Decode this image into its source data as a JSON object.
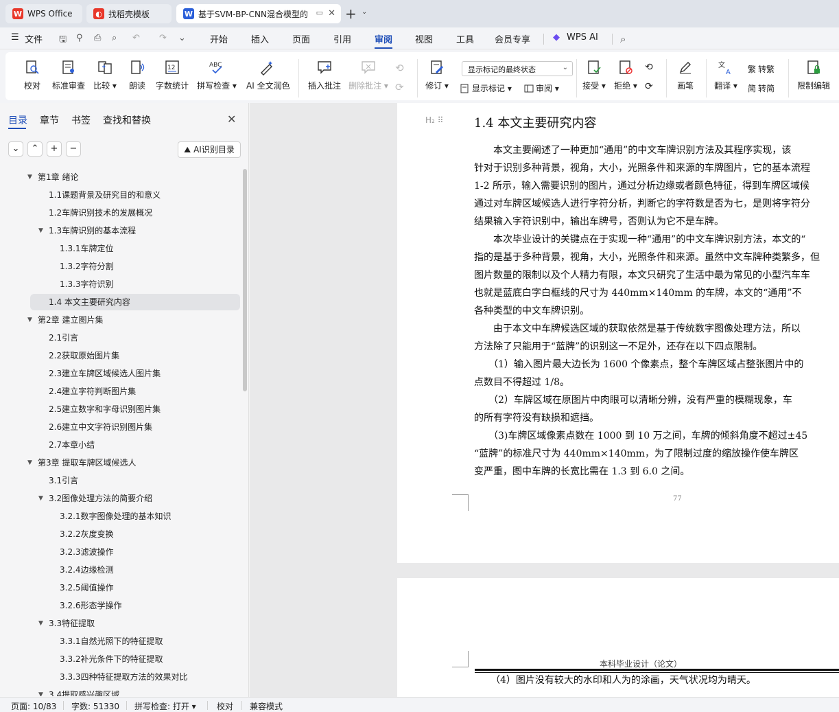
{
  "tabs": [
    {
      "label": "WPS Office",
      "icon": "wps-logo-icon",
      "color": "#e8372a"
    },
    {
      "label": "找稻壳模板",
      "icon": "daoke-icon",
      "color": "#e8372a"
    },
    {
      "label": "基于SVM-BP-CNN混合模型的",
      "icon": "word-doc-icon",
      "color": "#2b5fd9"
    }
  ],
  "menu": {
    "file": "文件",
    "items": [
      "开始",
      "插入",
      "页面",
      "引用",
      "审阅",
      "视图",
      "工具",
      "会员专享"
    ],
    "active": "审阅",
    "wps_ai": "WPS AI"
  },
  "ribbon": {
    "buttons": [
      {
        "label": "校对",
        "icon": "proofread-icon"
      },
      {
        "label": "标准审查",
        "icon": "standard-review-icon"
      },
      {
        "label": "比较 ▾",
        "icon": "compare-icon"
      },
      {
        "label": "朗读",
        "icon": "read-aloud-icon"
      },
      {
        "label": "字数统计",
        "icon": "word-count-icon"
      },
      {
        "label": "拼写检查 ▾",
        "icon": "spellcheck-icon"
      },
      {
        "label": "AI 全文润色",
        "icon": "ai-polish-icon"
      },
      {
        "label": "插入批注",
        "icon": "insert-comment-icon"
      },
      {
        "label": "删除批注 ▾",
        "icon": "delete-comment-icon"
      },
      {
        "label": "修订 ▾",
        "icon": "track-changes-icon"
      },
      {
        "label": "接受 ▾",
        "icon": "accept-icon"
      },
      {
        "label": "拒绝 ▾",
        "icon": "reject-icon"
      },
      {
        "label": "画笔",
        "icon": "pen-icon"
      },
      {
        "label": "翻译 ▾",
        "icon": "translate-icon"
      },
      {
        "label": "限制编辑",
        "icon": "restrict-edit-icon"
      }
    ],
    "markup_select": "显示标记的最终状态",
    "show_markup": "显示标记 ▾",
    "review": "审阅 ▾",
    "to_traditional": "转繁",
    "to_simplified": "转简"
  },
  "nav": {
    "tabs": [
      "目录",
      "章节",
      "书签",
      "查找和替换"
    ],
    "active_tab": "目录",
    "ai_toc": "AI识别目录",
    "toc": [
      {
        "text": "第1章 绪论",
        "level": 1,
        "caret": true
      },
      {
        "text": "1.1课题背景及研究目的和意义",
        "level": 2
      },
      {
        "text": "1.2车牌识别技术的发展概况",
        "level": 2
      },
      {
        "text": "1.3车牌识别的基本流程",
        "level": 2,
        "caret": true
      },
      {
        "text": "1.3.1车牌定位",
        "level": 3
      },
      {
        "text": "1.3.2字符分割",
        "level": 3
      },
      {
        "text": "1.3.3字符识别",
        "level": 3
      },
      {
        "text": "1.4 本文主要研究内容",
        "level": 2,
        "selected": true
      },
      {
        "text": "第2章 建立图片集",
        "level": 1,
        "caret": true
      },
      {
        "text": "2.1引言",
        "level": 2
      },
      {
        "text": "2.2获取原始图片集",
        "level": 2
      },
      {
        "text": "2.3建立车牌区域候选人图片集",
        "level": 2
      },
      {
        "text": "2.4建立字符判断图片集",
        "level": 2
      },
      {
        "text": "2.5建立数字和字母识别图片集",
        "level": 2
      },
      {
        "text": "2.6建立中文字符识别图片集",
        "level": 2
      },
      {
        "text": "2.7本章小结",
        "level": 2
      },
      {
        "text": "第3章 提取车牌区域候选人",
        "level": 1,
        "caret": true
      },
      {
        "text": "3.1引言",
        "level": 2
      },
      {
        "text": "3.2图像处理方法的简要介绍",
        "level": 2,
        "caret": true
      },
      {
        "text": "3.2.1数字图像处理的基本知识",
        "level": 3
      },
      {
        "text": "3.2.2灰度变换",
        "level": 3
      },
      {
        "text": "3.2.3滤波操作",
        "level": 3
      },
      {
        "text": "3.2.4边缘检测",
        "level": 3
      },
      {
        "text": "3.2.5阈值操作",
        "level": 3
      },
      {
        "text": "3.2.6形态学操作",
        "level": 3
      },
      {
        "text": "3.3特征提取",
        "level": 2,
        "caret": true
      },
      {
        "text": "3.3.1自然光照下的特征提取",
        "level": 3
      },
      {
        "text": "3.3.2补光条件下的特征提取",
        "level": 3
      },
      {
        "text": "3.3.3四种特征提取方法的效果对比",
        "level": 3
      },
      {
        "text": "3.4提取感兴趣区域",
        "level": 2,
        "caret": true
      }
    ]
  },
  "document": {
    "heading": "1.4 本文主要研究内容",
    "lines": [
      "　　本文主要阐述了一种更加“通用”的中文车牌识别方法及其程序实现，该",
      "针对于识别多种背景，视角，大小，光照条件和来源的车牌图片，它的基本流程",
      "1-2 所示，输入需要识别的图片，通过分析边缘或者颜色特征，得到车牌区域候",
      "通过对车牌区域候选人进行字符分析，判断它的字符数是否为七，是则将字符分",
      "结果输入字符识别中，输出车牌号，否则认为它不是车牌。",
      "　　本次毕业设计的关键点在于实现一种“通用”的中文车牌识别方法，本文的“",
      "指的是基于多种背景，视角，大小，光照条件和来源。虽然中文车牌种类繁多，但",
      "图片数量的限制以及个人精力有限，本文只研究了生活中最为常见的小型汽车车",
      "也就是蓝底白字白框线的尺寸为 440mm×140mm 的车牌，本文的“通用”不",
      "各种类型的中文车牌识别。",
      "　　由于本文中车牌候选区域的获取依然是基于传统数字图像处理方法，所以",
      "方法除了只能用于“蓝牌”的识别这一不足外，还存在以下四点限制。",
      "　　（1）输入图片最大边长为 1600 个像素点，整个车牌区域占整张图片中的",
      "点数目不得超过 1/8。",
      "　　（2）车牌区域在原图片中肉眼可以清晰分辨，没有严重的模糊现象，车",
      "的所有字符没有缺损和遮挡。",
      "　　（3)车牌区域像素点数在 1000 到 10 万之间，车牌的倾斜角度不超过±45",
      "“蓝牌”的标准尺寸为 440mm×140mm，为了限制过度的缩放操作使车牌区",
      "变严重，图中车牌的长宽比需在 1.3 到 6.0 之间。"
    ],
    "page_number": "77",
    "footer": "本科毕业设计（论文）",
    "next_line": "（4）图片没有较大的水印和人为的涂画，天气状况均为晴天。"
  },
  "status": {
    "page": "页面: 10/83",
    "words": "字数: 51330",
    "spell": "拼写检查: 打开 ▾",
    "proof": "校对",
    "compat": "兼容模式"
  }
}
